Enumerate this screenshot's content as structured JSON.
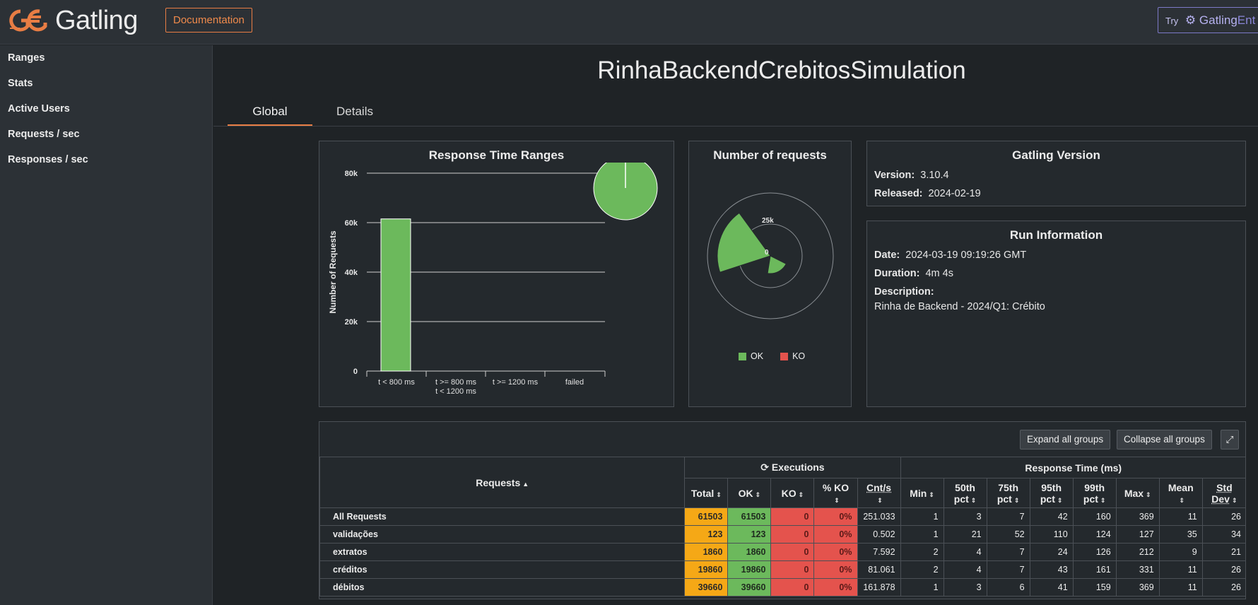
{
  "header": {
    "logo_text": "Gatling",
    "documentation_label": "Documentation",
    "try_label": "Try",
    "try_brand": "Gatling",
    "try_brand_suffix": "Ent"
  },
  "sidebar": {
    "items": [
      {
        "label": "Ranges"
      },
      {
        "label": "Stats"
      },
      {
        "label": "Active Users"
      },
      {
        "label": "Requests / sec"
      },
      {
        "label": "Responses / sec"
      }
    ]
  },
  "page": {
    "title": "RinhaBackendCrebitosSimulation",
    "tabs": [
      {
        "label": "Global"
      },
      {
        "label": "Details"
      }
    ]
  },
  "response_time_ranges": {
    "title": "Response Time Ranges",
    "ylabel": "Number of Requests",
    "y_ticks": [
      "80k",
      "60k",
      "40k",
      "20k",
      "0"
    ],
    "x_labels": [
      "t < 800 ms",
      "t >= 800 ms",
      "t < 1200 ms",
      "t >= 1200 ms",
      "failed"
    ]
  },
  "number_of_requests": {
    "title": "Number of requests",
    "ring_labels": [
      "25k",
      "0"
    ],
    "legend": [
      {
        "label": "OK",
        "color": "#6cb95c"
      },
      {
        "label": "KO",
        "color": "#e4534d"
      }
    ]
  },
  "gatling_version": {
    "title": "Gatling Version",
    "version_label": "Version:",
    "version": "3.10.4",
    "released_label": "Released:",
    "released": "2024-02-19"
  },
  "run_information": {
    "title": "Run Information",
    "date_label": "Date:",
    "date": "2024-03-19 09:19:26 GMT",
    "duration_label": "Duration:",
    "duration": "4m 4s",
    "description_label": "Description:",
    "description": "Rinha de Backend - 2024/Q1: Crébito"
  },
  "table": {
    "expand_label": "Expand all groups",
    "collapse_label": "Collapse all groups",
    "requests_header": "Requests",
    "executions_header": "Executions",
    "response_time_header": "Response Time (ms)",
    "col_total": "Total",
    "col_ok": "OK",
    "col_ko": "KO",
    "col_pko": "% KO",
    "col_cnt": "Cnt/s",
    "col_min": "Min",
    "col_p50a": "50th",
    "col_p50b": "pct",
    "col_p75a": "75th",
    "col_p75b": "pct",
    "col_p95a": "95th",
    "col_p95b": "pct",
    "col_p99a": "99th",
    "col_p99b": "pct",
    "col_max": "Max",
    "col_mean": "Mean",
    "col_stda": "Std",
    "col_stdb": "Dev",
    "rows": [
      {
        "name": "All Requests",
        "total": "61503",
        "ok": "61503",
        "ko": "0",
        "pko": "0%",
        "cnt": "251.033",
        "min": "1",
        "p50": "3",
        "p75": "7",
        "p95": "42",
        "p99": "160",
        "max": "369",
        "mean": "11",
        "std": "26"
      },
      {
        "name": "validações",
        "total": "123",
        "ok": "123",
        "ko": "0",
        "pko": "0%",
        "cnt": "0.502",
        "min": "1",
        "p50": "21",
        "p75": "52",
        "p95": "110",
        "p99": "124",
        "max": "127",
        "mean": "35",
        "std": "34"
      },
      {
        "name": "extratos",
        "total": "1860",
        "ok": "1860",
        "ko": "0",
        "pko": "0%",
        "cnt": "7.592",
        "min": "2",
        "p50": "4",
        "p75": "7",
        "p95": "24",
        "p99": "126",
        "max": "212",
        "mean": "9",
        "std": "21"
      },
      {
        "name": "créditos",
        "total": "19860",
        "ok": "19860",
        "ko": "0",
        "pko": "0%",
        "cnt": "81.061",
        "min": "2",
        "p50": "4",
        "p75": "7",
        "p95": "43",
        "p99": "161",
        "max": "331",
        "mean": "11",
        "std": "26"
      },
      {
        "name": "débitos",
        "total": "39660",
        "ok": "39660",
        "ko": "0",
        "pko": "0%",
        "cnt": "161.878",
        "min": "1",
        "p50": "3",
        "p75": "6",
        "p95": "41",
        "p99": "159",
        "max": "369",
        "mean": "11",
        "std": "26"
      }
    ]
  },
  "chart_data": [
    {
      "type": "bar",
      "title": "Response Time Ranges",
      "ylabel": "Number of Requests",
      "categories": [
        "t < 800 ms",
        "t >= 800 ms t < 1200 ms",
        "t >= 1200 ms",
        "failed"
      ],
      "values": [
        61503,
        0,
        0,
        0
      ],
      "ylim": [
        0,
        80000
      ],
      "colors": [
        "#6cb95c",
        "#f5a816",
        "#e4534d",
        "#e4534d"
      ]
    },
    {
      "type": "pie",
      "title": "Number of requests",
      "categories": [
        "OK",
        "KO"
      ],
      "values": [
        61503,
        0
      ],
      "colors": [
        "#6cb95c",
        "#e4534d"
      ]
    }
  ]
}
